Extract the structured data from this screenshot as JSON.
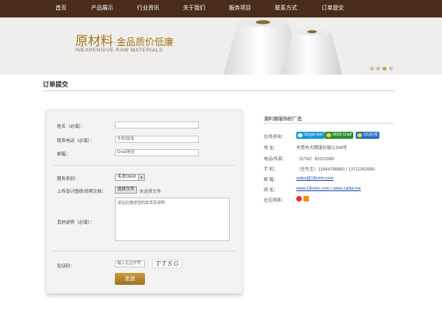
{
  "nav": {
    "items": [
      "首页",
      "产品展示",
      "行业资讯",
      "关于我们",
      "服务项目",
      "联系方式",
      "订单提交"
    ]
  },
  "banner": {
    "title_main": "原材料",
    "title_sep": "·",
    "title_rest": "金品质价低廉",
    "subtitle": "INEXPENSIVE RAW MATERIALS",
    "active_slide": 3,
    "slide_count": 4
  },
  "page": {
    "title": "订单提交"
  },
  "form": {
    "name_label": "姓名（必填）：",
    "phone_label": "联系电话（必填）：",
    "phone_placeholder": "手机/固话",
    "email_label": "邮箱：",
    "email_placeholder": "Email地址",
    "service_label": "服务类别：",
    "service_value": "毛衣OEM",
    "upload_label": "上传设计图纸/说明文档：",
    "upload_button": "选择文件",
    "upload_status": "未选择文件",
    "notes_label": "其他说明（必填）：",
    "notes_placeholder": "请在此描述您的需求及说明",
    "captcha_label": "验证码：",
    "captcha_placeholder": "输入左边字符",
    "captcha_text": "TTSG",
    "submit_label": "发送"
  },
  "contact": {
    "company": "澳利德服饰织厂造",
    "online_label": "在线咨询：",
    "skype_label": "Skype me!",
    "msn_label": "MSN Chat!",
    "qq_label": "QQ在线",
    "address_label": "地  址：",
    "address_value": "东莞市大朗镇长塘公308号",
    "tel_label": "电话/传真：",
    "tel_value": "（0769）83101089",
    "mobile_label": "手  机：",
    "mobile_value": "（庄先生）13544788883 / 13711992689",
    "email_label": "邮  箱：",
    "email_value": "sales@18oem.com",
    "web_label": "网  址：",
    "web_value": "www.18oem.com / www.callat.me",
    "social_label": "社区网络：",
    "colors": {
      "skype": "#1a9ad8",
      "msn": "#2f8f2f",
      "qq": "#2a6fc0",
      "weibo": "#e03030",
      "rss": "#f28d1b"
    }
  }
}
